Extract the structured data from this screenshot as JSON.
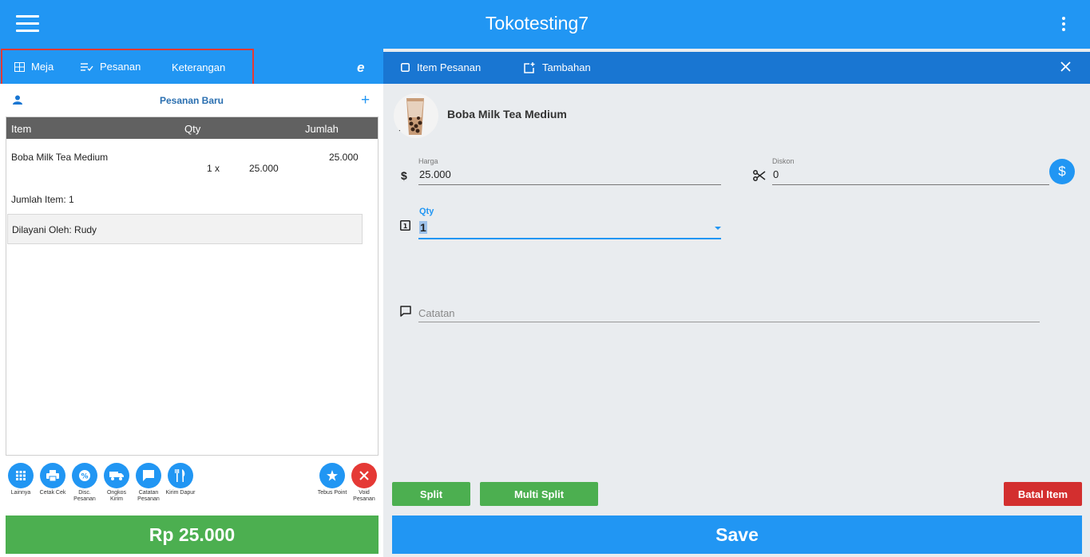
{
  "app": {
    "title": "Tokotesting7"
  },
  "left_tabs": {
    "meja": "Meja",
    "pesanan": "Pesanan",
    "keterangan": "Keterangan"
  },
  "order": {
    "title": "Pesanan Baru",
    "headers": {
      "item": "Item",
      "qty": "Qty",
      "jumlah": "Jumlah"
    },
    "item": {
      "name": "Boba Milk Tea Medium",
      "qty": "1 x",
      "price": "25.000",
      "amount": "25.000"
    },
    "jumlah_item": "Jumlah Item: 1",
    "dilayani": "Dilayani Oleh: Rudy"
  },
  "actions": {
    "lainnya": "Lainnya",
    "cetak_cek": "Cetak Cek",
    "disc_pesanan": "Disc. Pesanan",
    "ongkos_kirim": "Ongkos Kirim",
    "catatan_pesanan": "Catatan Pesanan",
    "kirim_dapur": "Kirim Dapur",
    "tebus_point": "Tebus Point",
    "void_pesanan": "Void Pesanan"
  },
  "total": "Rp 25.000",
  "right_tabs": {
    "item_pesanan": "Item Pesanan",
    "tambahan": "Tambahan"
  },
  "product": {
    "name": "Boba Milk Tea Medium"
  },
  "form": {
    "harga_label": "Harga",
    "harga_value": "25.000",
    "diskon_label": "Diskon",
    "diskon_value": "0",
    "qty_label": "Qty",
    "qty_value": "1",
    "catatan_placeholder": "Catatan"
  },
  "buttons": {
    "split": "Split",
    "multi_split": "Multi Split",
    "batal_item": "Batal Item",
    "save": "Save"
  },
  "colors": {
    "primary": "#2196f3",
    "dark_primary": "#1976d2",
    "green": "#4caf50",
    "red": "#d32f2f",
    "highlight_border": "#e53935"
  }
}
